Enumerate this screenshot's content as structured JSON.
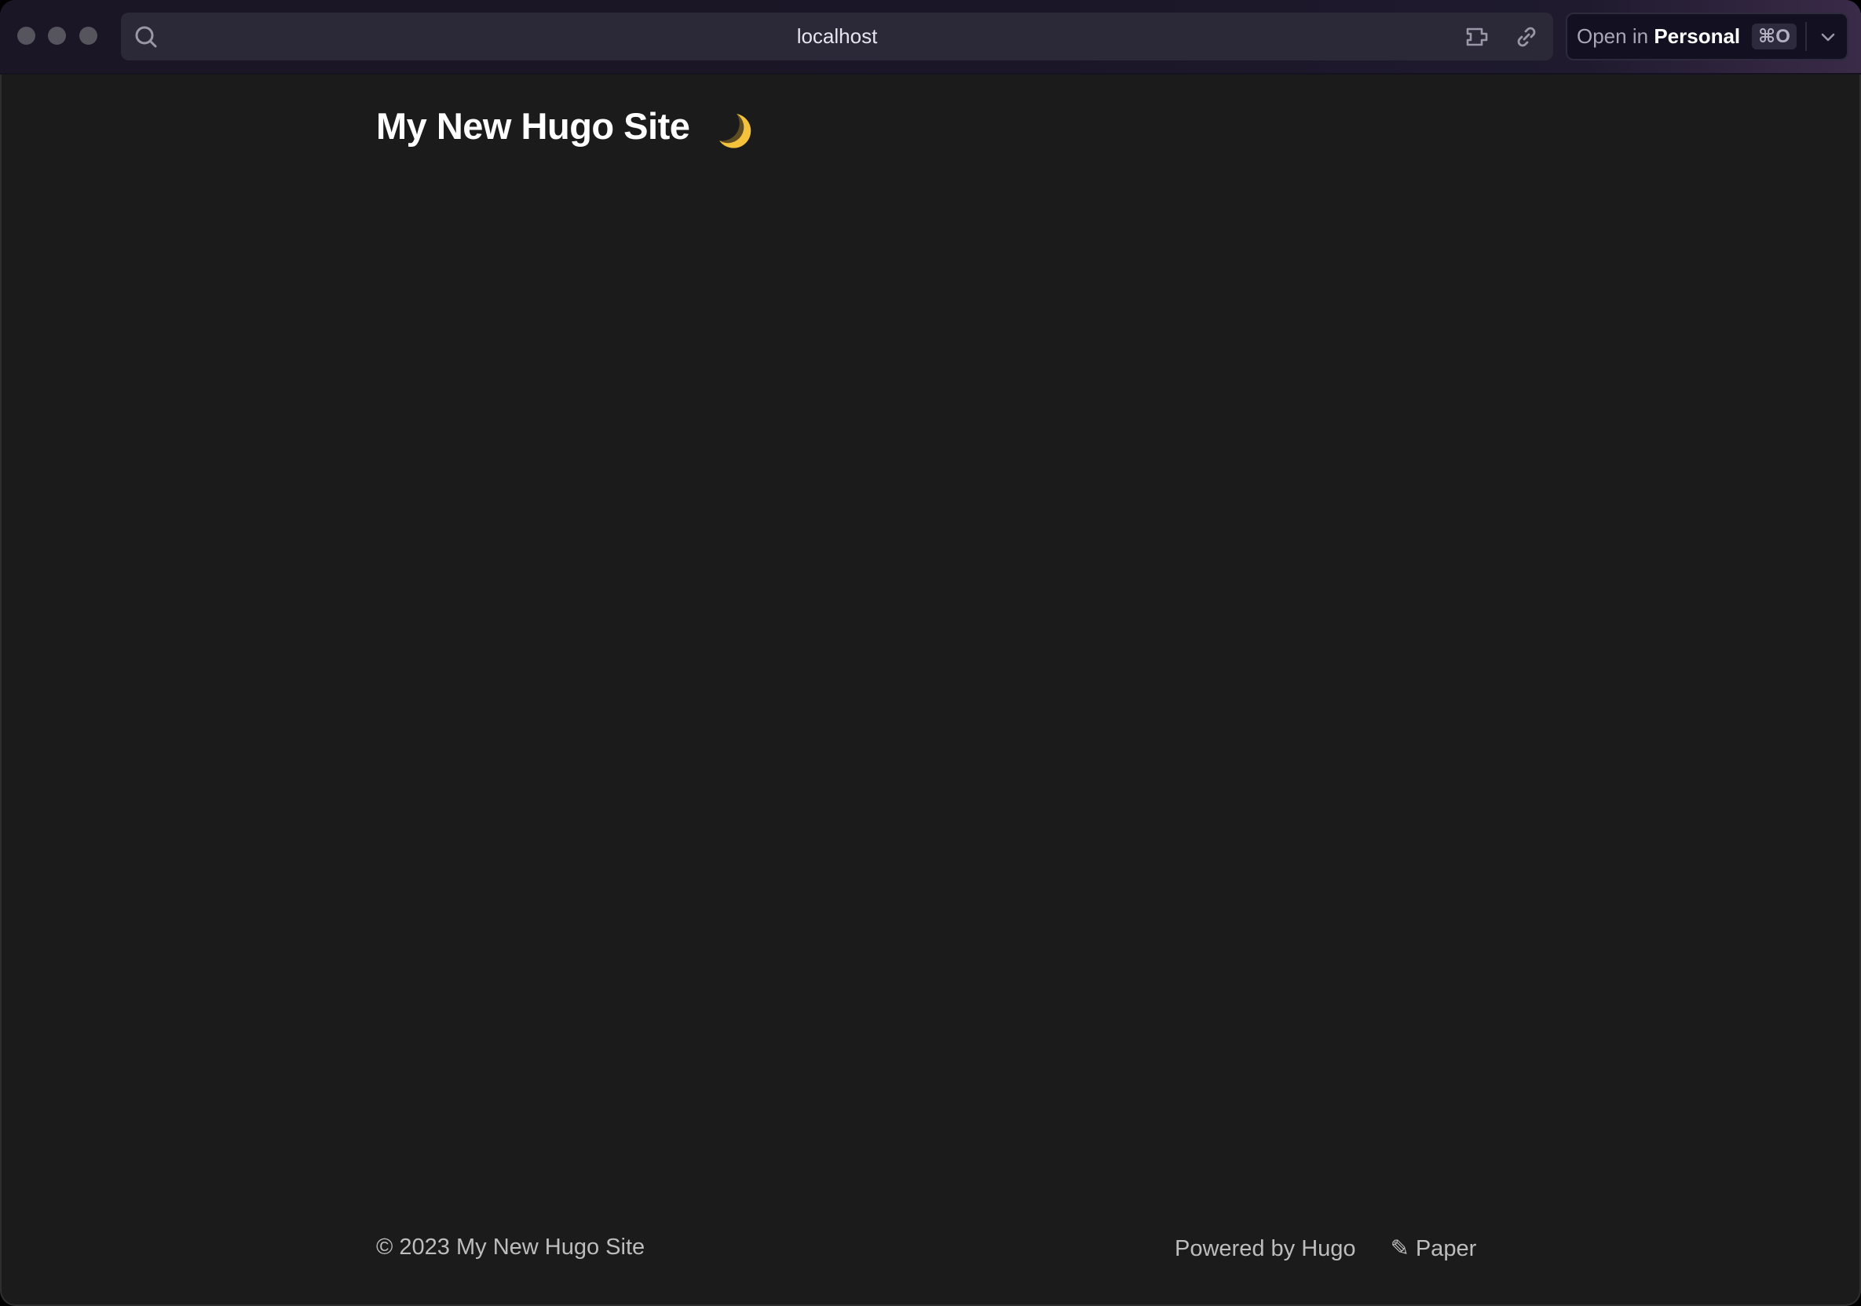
{
  "browser": {
    "url": "localhost",
    "open_in": {
      "prefix": "Open in",
      "profile": "Personal",
      "shortcut": "⌘O"
    },
    "icons": [
      "search-icon",
      "extension-icon",
      "link-icon",
      "chevron-down-icon"
    ]
  },
  "site": {
    "title": "My New Hugo Site",
    "theme_toggle_icon": "moon-icon",
    "theme_toggle_glyph": "🌙"
  },
  "footer": {
    "copyright": "© 2023 My New Hugo Site",
    "powered_by": "Powered by Hugo",
    "pencil_glyph": "✎",
    "theme_name": "Paper"
  },
  "colors": {
    "background": "#1b1b1b",
    "title": "#ffffff",
    "footer_text": "#bdbdbd",
    "moon": "#f5c33b"
  }
}
